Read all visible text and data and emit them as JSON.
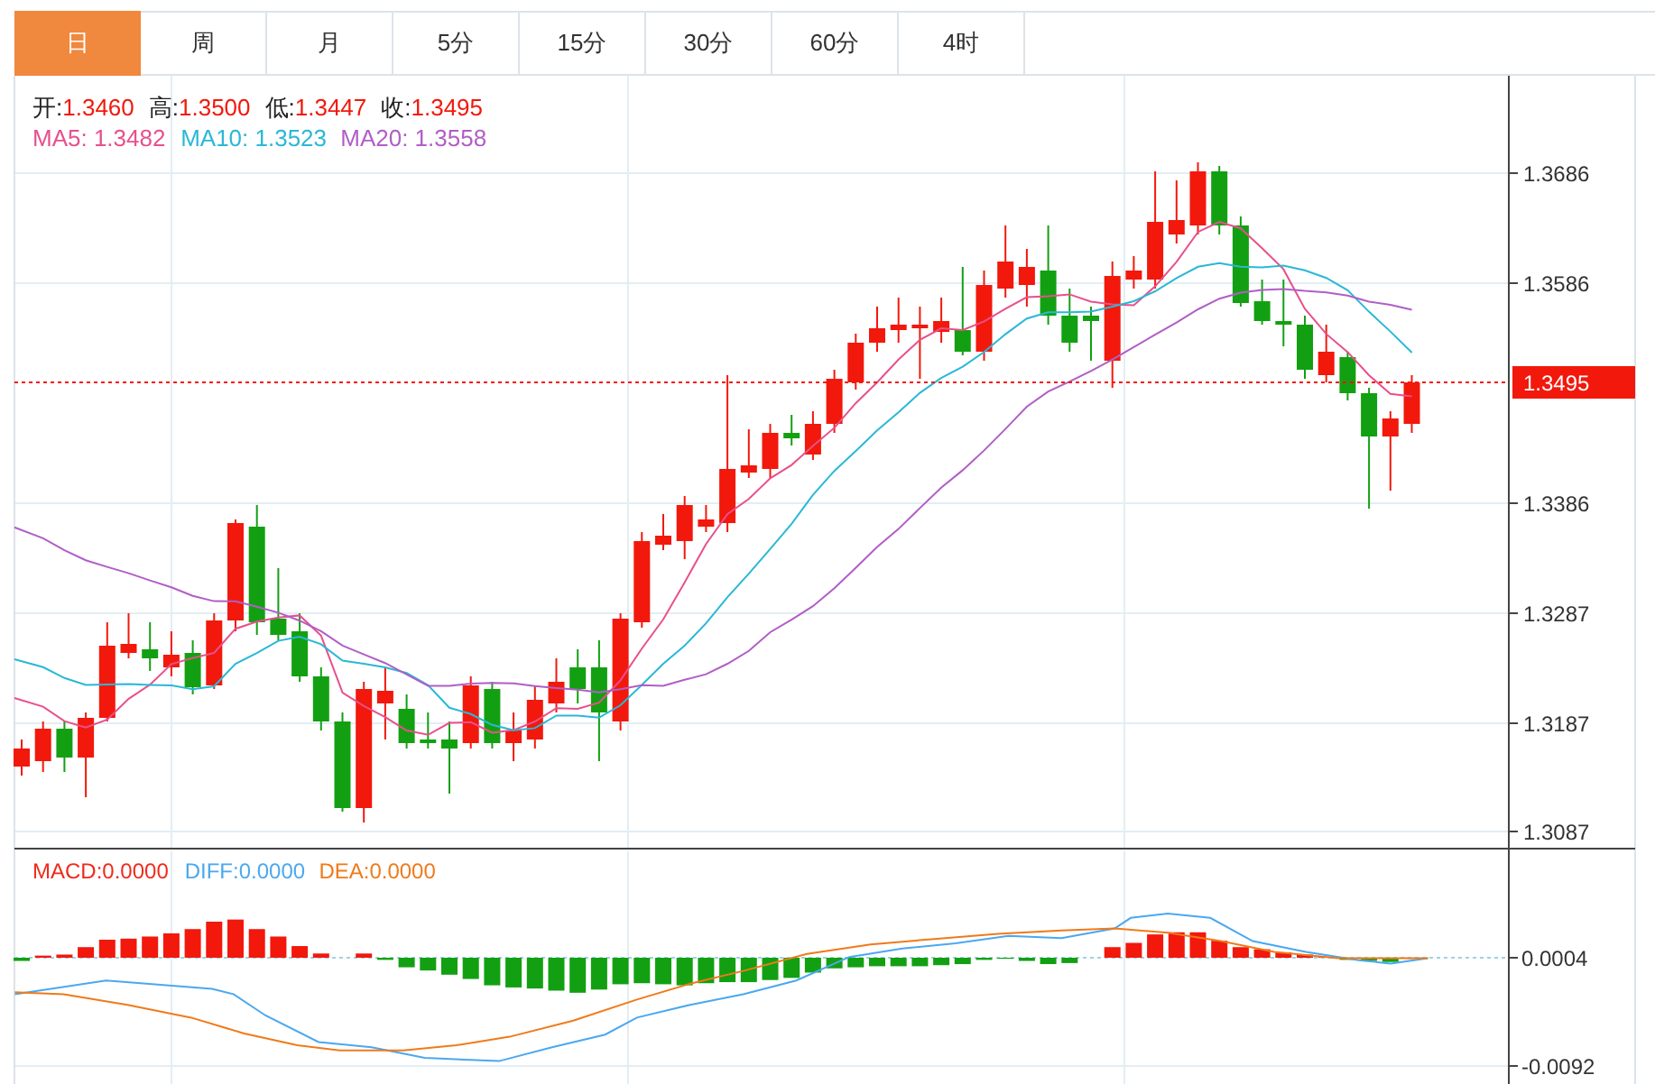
{
  "tabs": [
    {
      "label": "日",
      "selected": true
    },
    {
      "label": "周",
      "selected": false
    },
    {
      "label": "月",
      "selected": false
    },
    {
      "label": "5分",
      "selected": false
    },
    {
      "label": "15分",
      "selected": false
    },
    {
      "label": "30分",
      "selected": false
    },
    {
      "label": "60分",
      "selected": false
    },
    {
      "label": "4时",
      "selected": false
    }
  ],
  "ohlc_legend": [
    {
      "label": "开:",
      "value": "1.3460"
    },
    {
      "label": "高:",
      "value": "1.3500"
    },
    {
      "label": "低:",
      "value": "1.3447"
    },
    {
      "label": "收:",
      "value": "1.3495"
    }
  ],
  "ma_legend": [
    {
      "label": "MA5: 1.3482",
      "color": "#e8508c"
    },
    {
      "label": "MA10: 1.3523",
      "color": "#2ab8d6"
    },
    {
      "label": "MA20: 1.3558",
      "color": "#b15ec6"
    }
  ],
  "price_axis": [
    "1.3686",
    "1.3586",
    "1.3386",
    "1.3287",
    "1.3187",
    "1.3087"
  ],
  "current_price": "1.3495",
  "macd_legend": [
    {
      "label": "MACD:0.0000",
      "color": "#f02a1a"
    },
    {
      "label": "DIFF:0.0000",
      "color": "#4aa8f0"
    },
    {
      "label": "DEA:0.0000",
      "color": "#f07a1a"
    }
  ],
  "macd_axis": [
    "0.0004",
    "-0.0092"
  ]
}
